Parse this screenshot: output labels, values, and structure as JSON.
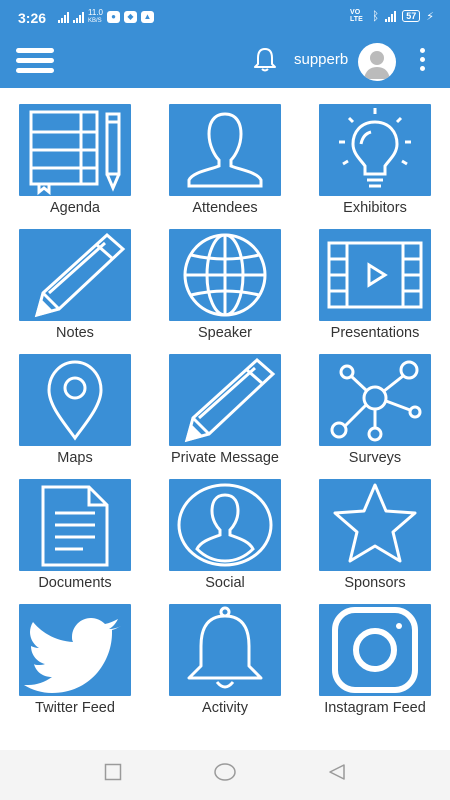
{
  "status_bar": {
    "time": "3:26",
    "net_speed": "11.0",
    "net_unit": "KB/S",
    "volte": "VO LTE",
    "battery": "57"
  },
  "app_bar": {
    "username": "supperb"
  },
  "tiles": [
    {
      "label": "Agenda",
      "icon": "agenda-icon"
    },
    {
      "label": "Attendees",
      "icon": "attendees-icon"
    },
    {
      "label": "Exhibitors",
      "icon": "exhibitors-icon"
    },
    {
      "label": "Notes",
      "icon": "notes-icon"
    },
    {
      "label": "Speaker",
      "icon": "speaker-icon"
    },
    {
      "label": "Presentations",
      "icon": "presentations-icon"
    },
    {
      "label": "Maps",
      "icon": "maps-icon"
    },
    {
      "label": "Private Message",
      "icon": "private-message-icon"
    },
    {
      "label": "Surveys",
      "icon": "surveys-icon"
    },
    {
      "label": "Documents",
      "icon": "documents-icon"
    },
    {
      "label": "Social",
      "icon": "social-icon"
    },
    {
      "label": "Sponsors",
      "icon": "sponsors-icon"
    },
    {
      "label": "Twitter Feed",
      "icon": "twitter-feed-icon"
    },
    {
      "label": "Activity",
      "icon": "activity-icon"
    },
    {
      "label": "Instagram Feed",
      "icon": "instagram-feed-icon"
    }
  ],
  "colors": {
    "primary": "#3a8fd6",
    "label_text": "#333333",
    "nav_bar": "#f4f4f4"
  }
}
